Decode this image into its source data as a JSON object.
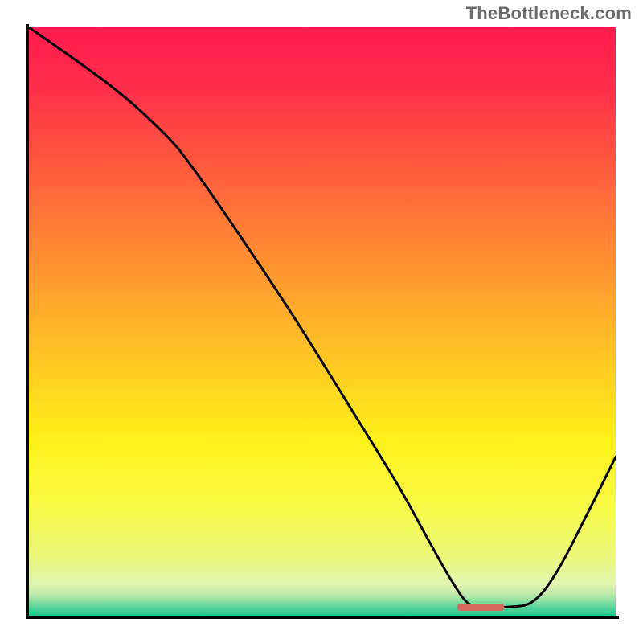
{
  "watermark": "TheBottleneck.com",
  "colors": {
    "gradient_stops": [
      {
        "offset": 0.0,
        "color": "#ff1a4f"
      },
      {
        "offset": 0.1,
        "color": "#ff2e4a"
      },
      {
        "offset": 0.22,
        "color": "#ff5540"
      },
      {
        "offset": 0.38,
        "color": "#ff8a33"
      },
      {
        "offset": 0.55,
        "color": "#ffc226"
      },
      {
        "offset": 0.7,
        "color": "#fff01a"
      },
      {
        "offset": 0.82,
        "color": "#f8fb4a"
      },
      {
        "offset": 0.9,
        "color": "#eaf97a"
      },
      {
        "offset": 0.945,
        "color": "#e3f6b0"
      },
      {
        "offset": 0.965,
        "color": "#b9e8a8"
      },
      {
        "offset": 0.985,
        "color": "#5cd49b"
      },
      {
        "offset": 1.0,
        "color": "#18c98b"
      }
    ],
    "curve": "#000000",
    "marker": "#d46a5c",
    "frame": "#000000"
  },
  "chart_data": {
    "type": "line",
    "title": "",
    "xlabel": "",
    "ylabel": "",
    "xlim": [
      0,
      100
    ],
    "ylim": [
      0,
      100
    ],
    "grid": false,
    "legend": false,
    "series": [
      {
        "name": "bottleneck-curve",
        "x": [
          0,
          14,
          23,
          28,
          35,
          45,
          55,
          63,
          68,
          72,
          75,
          78,
          82,
          86,
          90,
          95,
          100
        ],
        "values": [
          100,
          90,
          82,
          76,
          66,
          51,
          35,
          22,
          13,
          6,
          2,
          1.5,
          1.5,
          2.5,
          7.5,
          17,
          27
        ]
      }
    ],
    "markers": [
      {
        "name": "optimal-band",
        "x_center": 77,
        "y": 1.5,
        "half_width": 4
      }
    ]
  }
}
